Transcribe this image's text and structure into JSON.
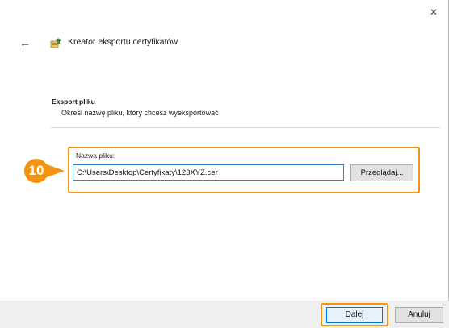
{
  "window": {
    "title": "Kreator eksportu certyfikatów",
    "close_label": "×",
    "back_label": "←"
  },
  "section": {
    "heading": "Eksport pliku",
    "description": "Określ nazwę pliku, który chcesz wyeksportować"
  },
  "file": {
    "label": "Nazwa pliku:",
    "value": "C:\\Users\\Desktop\\Certyfikaty\\123XYZ.cer",
    "browse_label": "Przeglądaj..."
  },
  "step": {
    "number": "10",
    "accent_color": "#f29412"
  },
  "footer": {
    "next_label": "Dalej",
    "cancel_label": "Anuluj"
  },
  "icons": {
    "wizard": "certificate-wizard-icon",
    "back": "back-arrow-icon",
    "close": "close-icon"
  }
}
